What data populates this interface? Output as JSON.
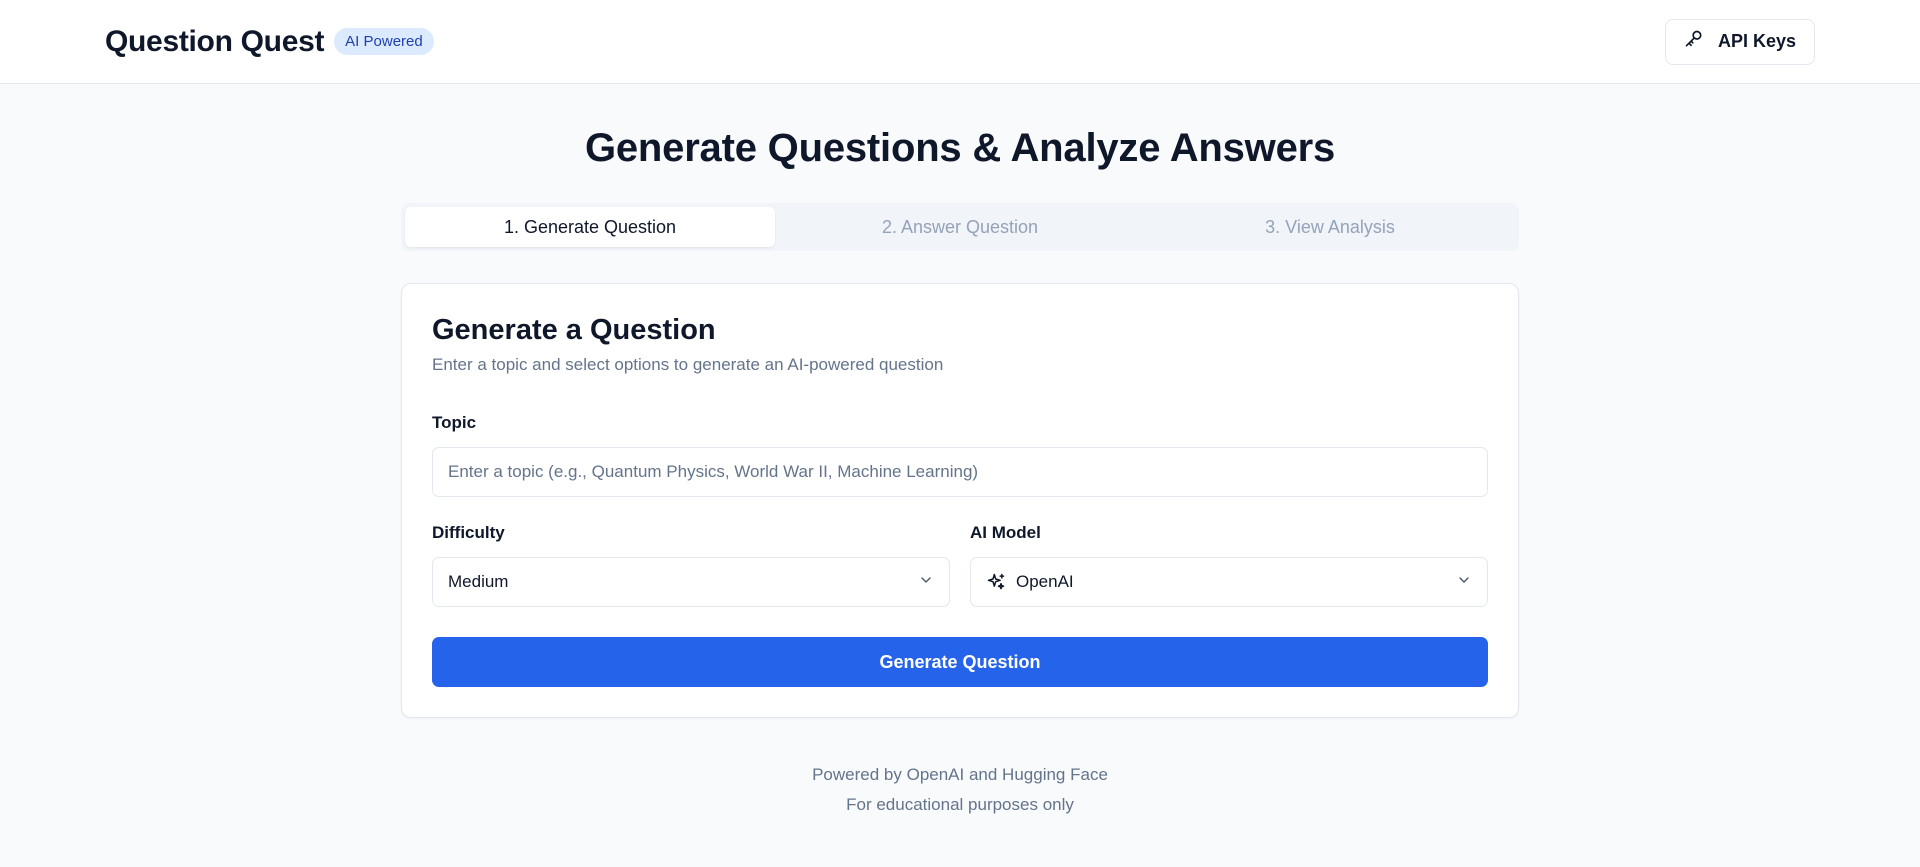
{
  "header": {
    "title": "Question Quest",
    "badge": "AI Powered",
    "api_keys_label": "API Keys"
  },
  "main": {
    "page_title": "Generate Questions & Analyze Answers",
    "steps": [
      {
        "label": "1. Generate Question",
        "active": true
      },
      {
        "label": "2. Answer Question",
        "active": false
      },
      {
        "label": "3. View Analysis",
        "active": false
      }
    ]
  },
  "form": {
    "title": "Generate a Question",
    "subtitle": "Enter a topic and select options to generate an AI-powered question",
    "topic_label": "Topic",
    "topic_placeholder": "Enter a topic (e.g., Quantum Physics, World War II, Machine Learning)",
    "topic_value": "",
    "difficulty_label": "Difficulty",
    "difficulty_value": "Medium",
    "model_label": "AI Model",
    "model_value": "OpenAI",
    "submit_label": "Generate Question"
  },
  "footer": {
    "line1": "Powered by OpenAI and Hugging Face",
    "line2": "For educational purposes only"
  },
  "icons": {
    "api_keys": "key-icon",
    "model": "sparkles-icon",
    "dropdown": "chevron-down-icon"
  },
  "colors": {
    "primary": "#2563eb",
    "badge_bg": "#dbeafe",
    "badge_text": "#1e40af",
    "background": "#f8fafc"
  }
}
